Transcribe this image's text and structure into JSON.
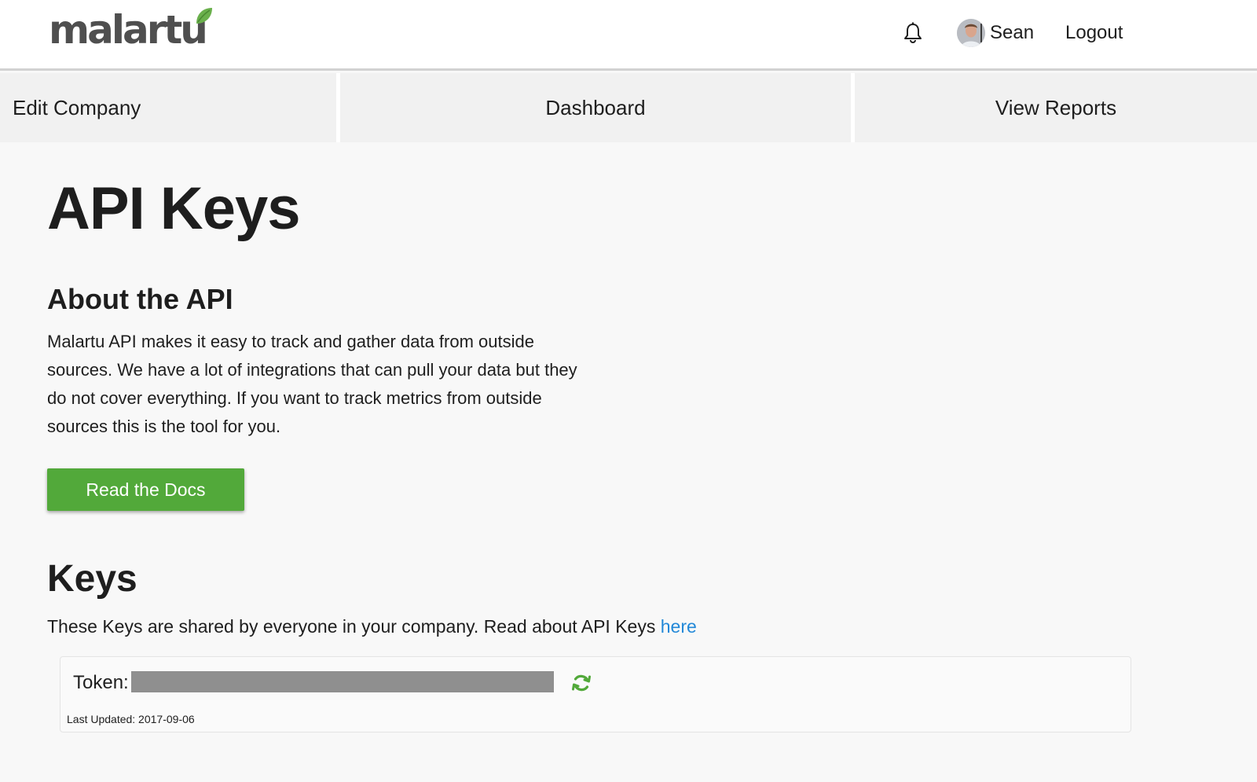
{
  "header": {
    "logo_text": "malartu",
    "user_name": "Sean",
    "logout_label": "Logout"
  },
  "nav": {
    "items": [
      {
        "label": "Edit Company"
      },
      {
        "label": "Dashboard"
      },
      {
        "label": "View Reports"
      }
    ]
  },
  "page": {
    "title": "API Keys",
    "about_title": "About the API",
    "about_text": "Malartu API makes it easy to track and gather data from outside sources. We have a lot of integrations that can pull your data but they do not cover everything. If you want to track metrics from outside sources this is the tool for you.",
    "docs_button": "Read the Docs",
    "keys_title": "Keys",
    "keys_text": "These Keys are shared by everyone in your company. Read about API Keys ",
    "keys_link": "here"
  },
  "token": {
    "label": "Token:",
    "last_updated": "Last Updated: 2017-09-06"
  },
  "colors": {
    "accent_green": "#52a93a",
    "link_blue": "#2288d8",
    "logo_gray": "#4f4f4f"
  },
  "icons": [
    "bell-icon",
    "refresh-icon",
    "leaf-icon"
  ]
}
